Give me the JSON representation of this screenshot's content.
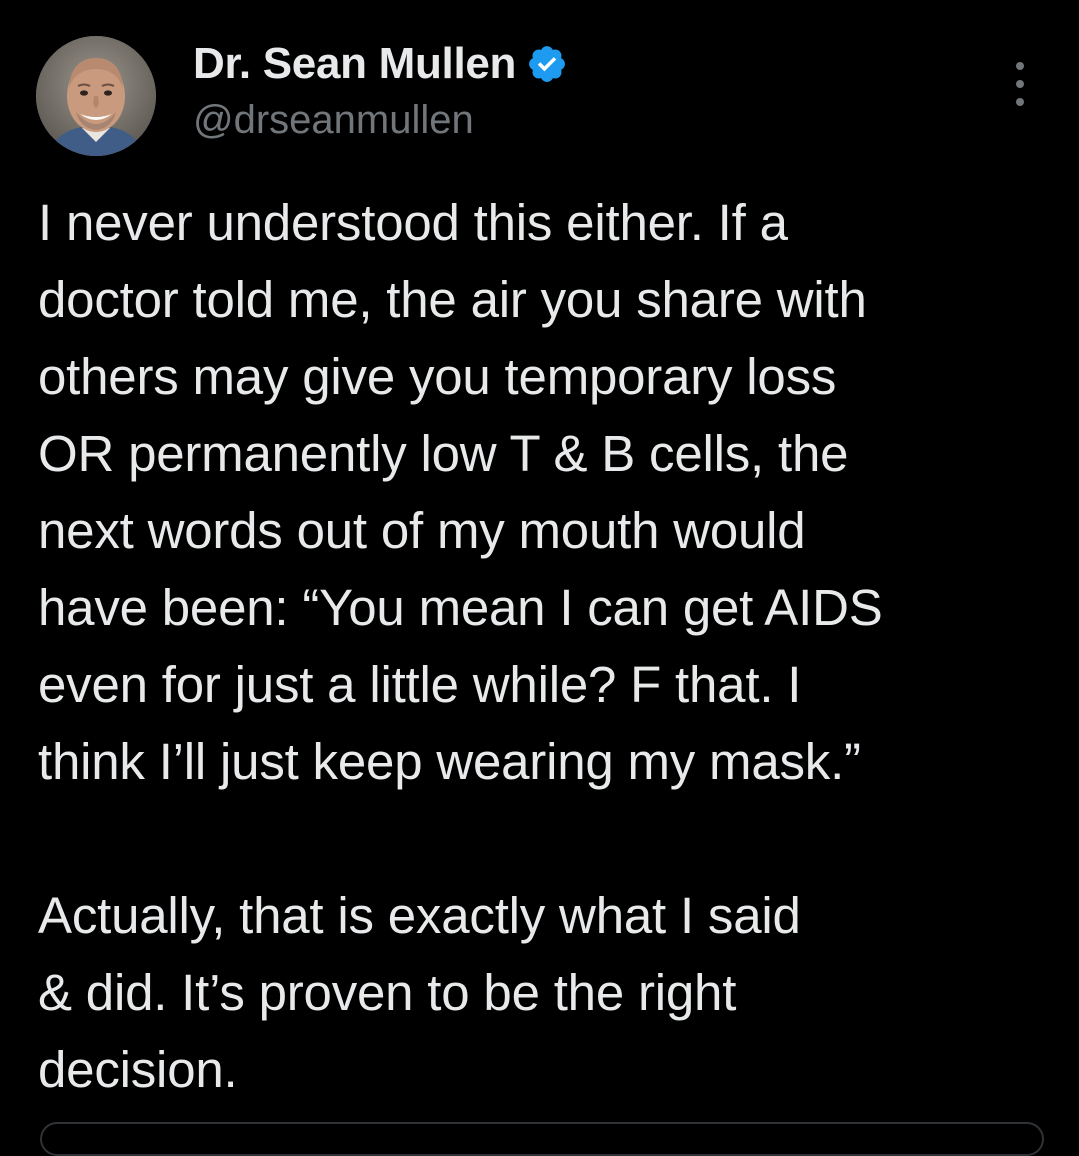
{
  "author": {
    "display_name": "Dr. Sean Mullen",
    "handle": "@drseanmullen",
    "verified_icon": "verified-badge-icon",
    "avatar_icon": "profile-photo"
  },
  "colors": {
    "background": "#000000",
    "text": "#e7e9ea",
    "secondary_text": "#71767b",
    "verified_blue": "#1d9bf0"
  },
  "more_icon": "more-options-icon",
  "tweet": {
    "lines": [
      "I never understood this either. If a",
      "doctor told me, the air you share with",
      "others may give you temporary loss",
      "OR permanently low T & B cells, the",
      "next words out of my mouth would",
      "have been: “You mean I can get AIDS",
      "even for just a little while? F that. I",
      "think I’ll just keep wearing my mask.”",
      "",
      "Actually, that is exactly what I said",
      "& did. It’s proven to be the right",
      "decision."
    ]
  }
}
